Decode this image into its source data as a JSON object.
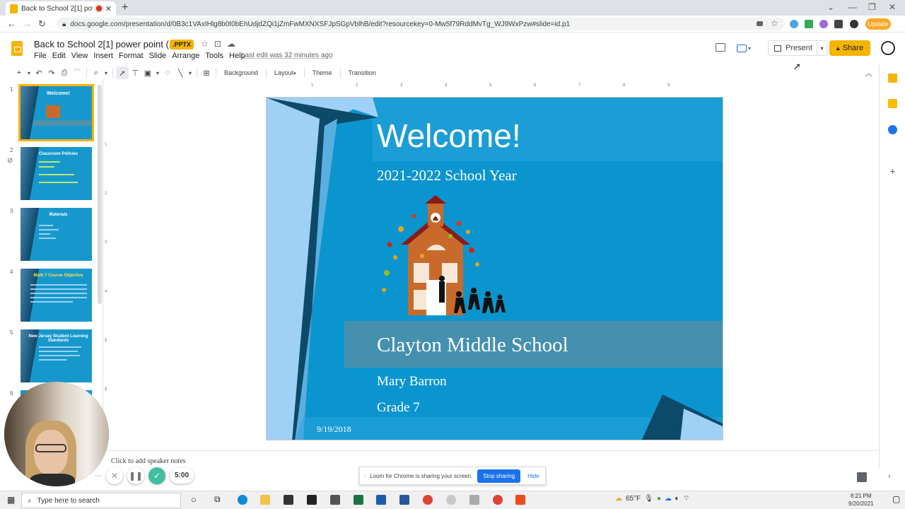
{
  "browser": {
    "tab_title": "Back to School 2[1] power p",
    "url": "docs.google.com/presentation/d/0B3c1VAxIHlg8b0I0bEhUdjdZQi1jZmFwMXNXSFJpSGpVblhB/edit?resourcekey=0-Mw5f79RddMvTg_WJ9WxPzw#slide=id.p1",
    "update_label": "Update"
  },
  "doc": {
    "title": "Back to School 2[1] power point (1)",
    "badge": ".PPTX",
    "last_edit": "Last edit was 32 minutes ago",
    "menu": [
      "File",
      "Edit",
      "View",
      "Insert",
      "Format",
      "Slide",
      "Arrange",
      "Tools",
      "Help"
    ],
    "present_label": "Present",
    "share_label": "Share"
  },
  "toolbar": {
    "background": "Background",
    "layout": "Layout",
    "theme": "Theme",
    "transition": "Transition"
  },
  "filmstrip": {
    "slides": [
      {
        "num": "1",
        "title": "Welcome!"
      },
      {
        "num": "2",
        "title": "Classroom Policies"
      },
      {
        "num": "3",
        "title": "Materials"
      },
      {
        "num": "4",
        "title": "Math 7 Course Objective"
      },
      {
        "num": "5",
        "title": "New Jersey Student Learning Standards"
      },
      {
        "num": "6",
        "title": ""
      }
    ]
  },
  "ruler": {
    "top": [
      "1",
      "2",
      "3",
      "4",
      "5",
      "6",
      "7",
      "8",
      "9"
    ],
    "left": [
      "1",
      "2",
      "3",
      "4",
      "5",
      "6"
    ]
  },
  "slide": {
    "title": "Welcome!",
    "subtitle": "2021-2022 School Year",
    "school": "Clayton Middle School",
    "teacher": "Mary Barron",
    "grade": "Grade  7",
    "date": "9/19/2018"
  },
  "notes": {
    "placeholder": "Click to add speaker notes"
  },
  "loom": {
    "timer": "5:00",
    "sharing_text": "Loom for Chrome is sharing your screen.",
    "stop_label": "Stop sharing",
    "hide_label": "Hide"
  },
  "taskbar": {
    "search_placeholder": "Type here to search",
    "temperature": "65°F",
    "time": "8:21 PM",
    "date": "9/20/2021"
  },
  "colors": {
    "slide_blue": "#0b95ce",
    "slides_yellow": "#f4b400",
    "stop_sharing_blue": "#1a73e8"
  }
}
